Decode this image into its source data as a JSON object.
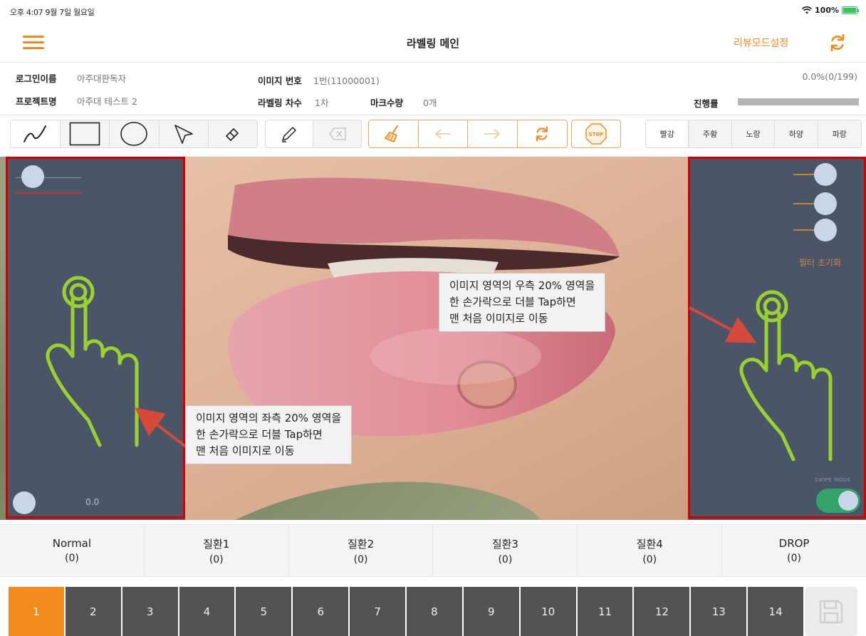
{
  "status_bar": {
    "time_date": "오후 4:07  9월 7일 월요일",
    "battery": "100%"
  },
  "nav": {
    "title": "라벨링 메인",
    "review_mode": "리뷰모드설정"
  },
  "info": {
    "login_label": "로그인이름",
    "login_value": "아주대판독자",
    "project_label": "프로젝트명",
    "project_value": "아주대 테스트 2",
    "image_no_label": "이미지 번호",
    "image_no_value": "1번(11000001)",
    "round_label": "라벨링 차수",
    "round_value": "1차",
    "mark_label": "마크수량",
    "mark_value": "0개",
    "progress_label": "진행률",
    "progress_text": "0.0%(0/199)",
    "progress_fraction": 0.0
  },
  "toolbar": {
    "colors": [
      "빨강",
      "주황",
      "노랑",
      "하양",
      "파랑"
    ],
    "selected_color": "빨강"
  },
  "image": {
    "left_callout": [
      "이미지 영역의 좌측 20% 영역을",
      "한 손가락으로 더블 Tap하면",
      "맨 처음 이미지로 이동"
    ],
    "right_callout": [
      "이미지 영역의 우측 20% 영역을",
      "한 손가락으로 더블 Tap하면",
      "맨 처음 이미지로 이동"
    ],
    "left_value": "0.0",
    "filter_reset": "필터 초기화",
    "swipe_mode": "SWIPE MODE"
  },
  "categories": [
    {
      "name": "Normal",
      "count": "(0)"
    },
    {
      "name": "질환1",
      "count": "(0)"
    },
    {
      "name": "질환2",
      "count": "(0)"
    },
    {
      "name": "질환3",
      "count": "(0)"
    },
    {
      "name": "질환4",
      "count": "(0)"
    },
    {
      "name": "DROP",
      "count": "(0)"
    }
  ],
  "pages": [
    "1",
    "2",
    "3",
    "4",
    "5",
    "6",
    "7",
    "8",
    "9",
    "10",
    "11",
    "12",
    "13",
    "14"
  ],
  "current_page": "1",
  "colors": {
    "accent": "#f28a1e",
    "highlight_frame": "#d40000",
    "panel": "#4a5568",
    "hand_outline": "#9bd12f",
    "toggle_on": "#34a36b"
  }
}
